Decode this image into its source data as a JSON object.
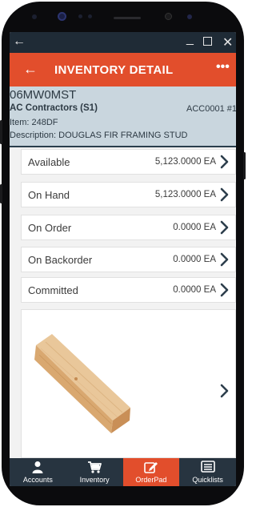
{
  "window": {
    "back_glyph": "←",
    "minimize_glyph": "_",
    "close_glyph": "✕"
  },
  "app_bar": {
    "back_glyph": "←",
    "title": "INVENTORY DETAIL",
    "more_glyph": "•••"
  },
  "item": {
    "code": "06MW0MST",
    "customer": "AC Contractors (S1)",
    "account": "ACC0001 #1",
    "item_line": "Item: 248DF",
    "description_line": "Description: DOUGLAS FIR FRAMING STUD"
  },
  "rows": [
    {
      "label": "Available",
      "value": "5,123.0000 EA"
    },
    {
      "label": "On Hand",
      "value": "5,123.0000 EA"
    },
    {
      "label": "On Order",
      "value": "0.0000 EA"
    },
    {
      "label": "On Backorder",
      "value": "0.0000 EA"
    },
    {
      "label": "Committed",
      "value": "0.0000 EA"
    }
  ],
  "image": {
    "icon": "lumber-photo"
  },
  "nav": [
    {
      "label": "Accounts",
      "icon": "person-icon",
      "active": false
    },
    {
      "label": "Inventory",
      "icon": "cart-icon",
      "active": false
    },
    {
      "label": "OrderPad",
      "icon": "edit-icon",
      "active": true
    },
    {
      "label": "Quicklists",
      "icon": "list-icon",
      "active": false
    }
  ],
  "colors": {
    "accent": "#e24e2c",
    "nav_bg": "#273440",
    "header_bg": "#c9d6de",
    "window_bar": "#1f2b36",
    "chevron": "#2d3e4c"
  }
}
